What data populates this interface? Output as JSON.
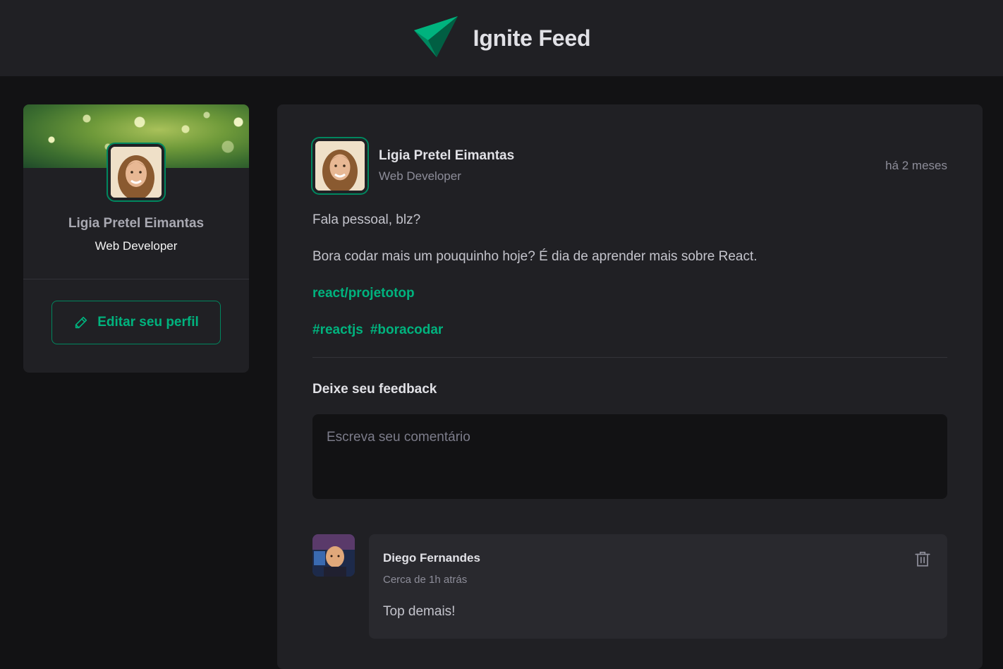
{
  "header": {
    "title": "Ignite Feed",
    "logo_icon": "ignite-logo-icon"
  },
  "sidebar": {
    "name": "Ligia Pretel Eimantas",
    "role": "Web Developer",
    "edit_button": "Editar seu perfil",
    "edit_icon": "pencil-icon"
  },
  "post": {
    "author": "Ligia Pretel Eimantas",
    "role": "Web Developer",
    "time": "há 2 meses",
    "paragraphs": [
      "Fala pessoal, blz?",
      "Bora codar mais um pouquinho hoje? É dia de aprender mais sobre React."
    ],
    "link": "react/projetotop",
    "tags": [
      "#reactjs",
      "#boracodar"
    ],
    "feedback_title": "Deixe seu feedback",
    "comment_placeholder": "Escreva seu comentário"
  },
  "comment": {
    "author": "Diego Fernandes",
    "time": "Cerca de 1h atrás",
    "text": "Top demais!",
    "delete_icon": "trash-icon"
  },
  "colors": {
    "accent": "#00b37e",
    "accent_dark": "#00875f",
    "background": "#121214",
    "surface": "#202024"
  }
}
